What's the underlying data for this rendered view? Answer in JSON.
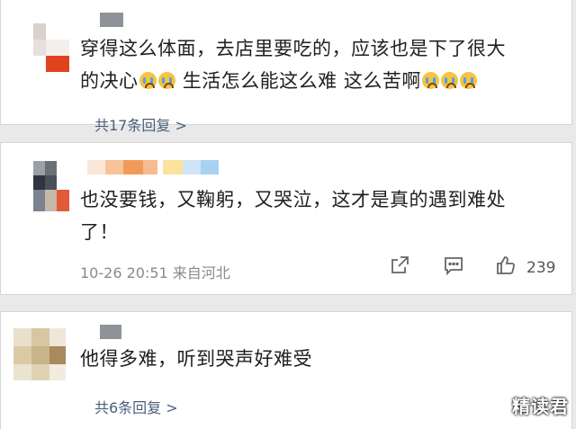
{
  "comment1": {
    "text_line1": "穿得这么体面，去店里要吃的，应该也是下了很大",
    "text_line2a": "的决心",
    "text_line2b": "生活怎么能这么难 这么苦啊",
    "replies": "共17条回复 >"
  },
  "comment2": {
    "text_line1": "也没要钱，又鞠躬，又哭泣，这才是真的遇到难处",
    "text_line2": "了！",
    "timestamp": "10-26 20:51 来自河北",
    "likes": "239"
  },
  "comment3": {
    "text": "他得多难，听到哭声好难受",
    "replies": "共6条回复 >"
  },
  "watermark": "精读君",
  "icons": [
    "crying-emoji-icon",
    "share-icon",
    "comment-icon",
    "like-icon",
    "chevron-right-icon"
  ]
}
